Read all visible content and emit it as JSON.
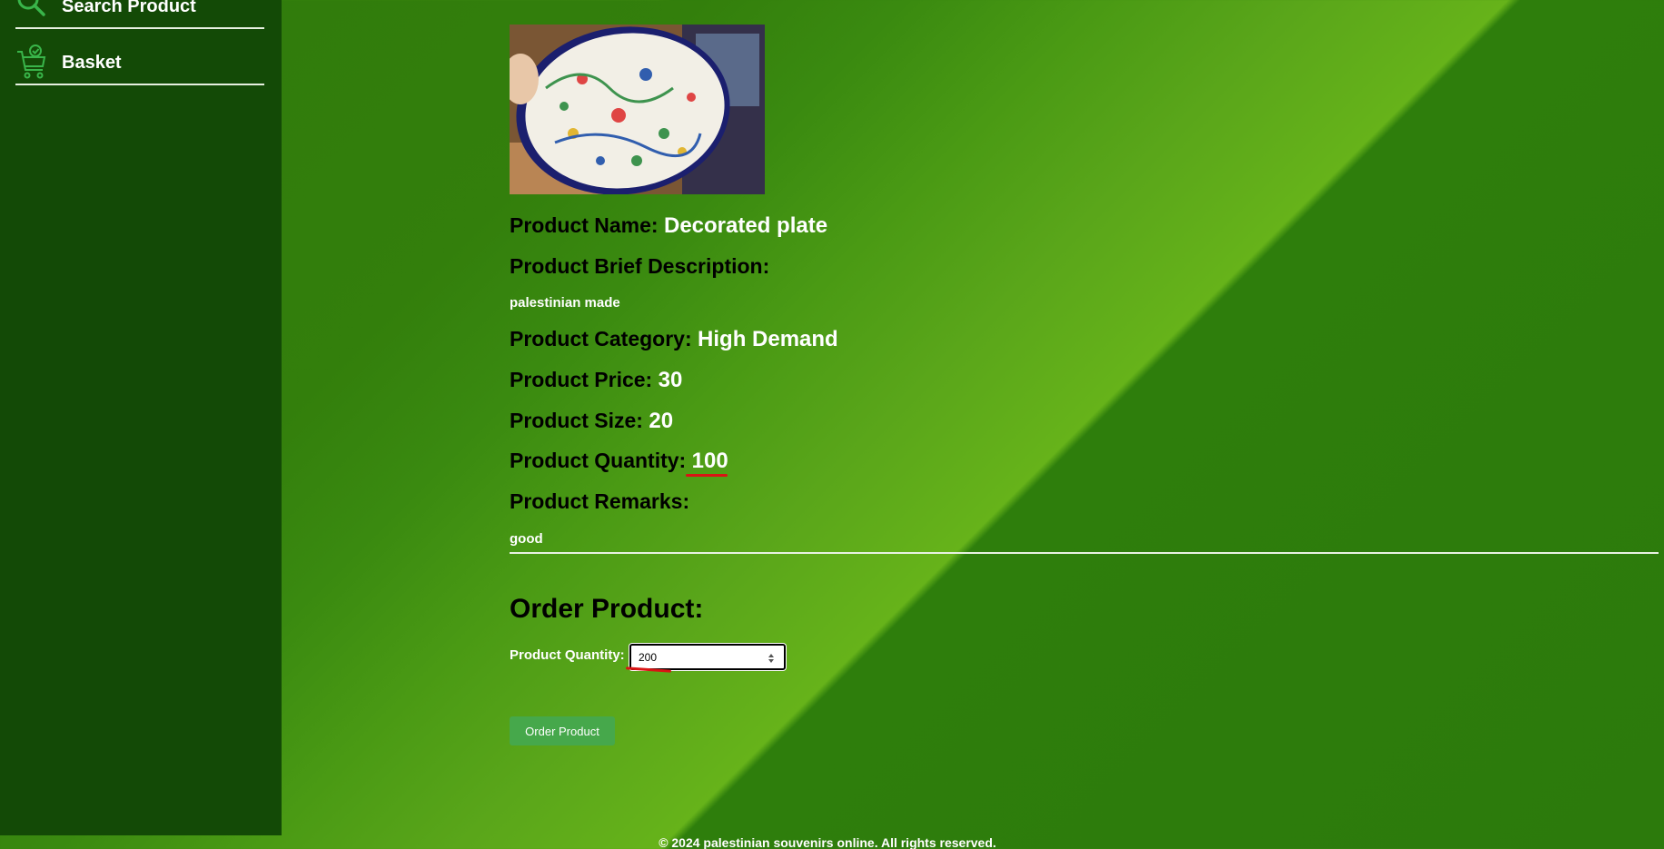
{
  "sidebar": {
    "items": [
      {
        "label": "Search Product",
        "icon": "search-icon"
      },
      {
        "label": "Basket",
        "icon": "basket-icon"
      }
    ]
  },
  "product": {
    "image_alt": "Decorated plate photo",
    "name_label": "Product Name:",
    "name_value": "Decorated plate",
    "desc_label": "Product Brief Description:",
    "desc_value": "palestinian made",
    "category_label": "Product Category:",
    "category_value": "High Demand",
    "price_label": "Product Price:",
    "price_value": "30",
    "size_label": "Product Size:",
    "size_value": "20",
    "quantity_label": "Product Quantity:",
    "quantity_value": "100",
    "remarks_label": "Product Remarks:",
    "remarks_value": "good"
  },
  "order": {
    "title": "Order Product:",
    "quantity_label": "Product Quantity:",
    "quantity_value": "200",
    "button_label": "Order Product"
  },
  "footer": {
    "text": "© 2024 palestinian souvenirs online. All rights reserved."
  },
  "colors": {
    "sidebar_bg": "#134a06",
    "button_bg": "#46a84b",
    "annotation": "#d91414"
  }
}
